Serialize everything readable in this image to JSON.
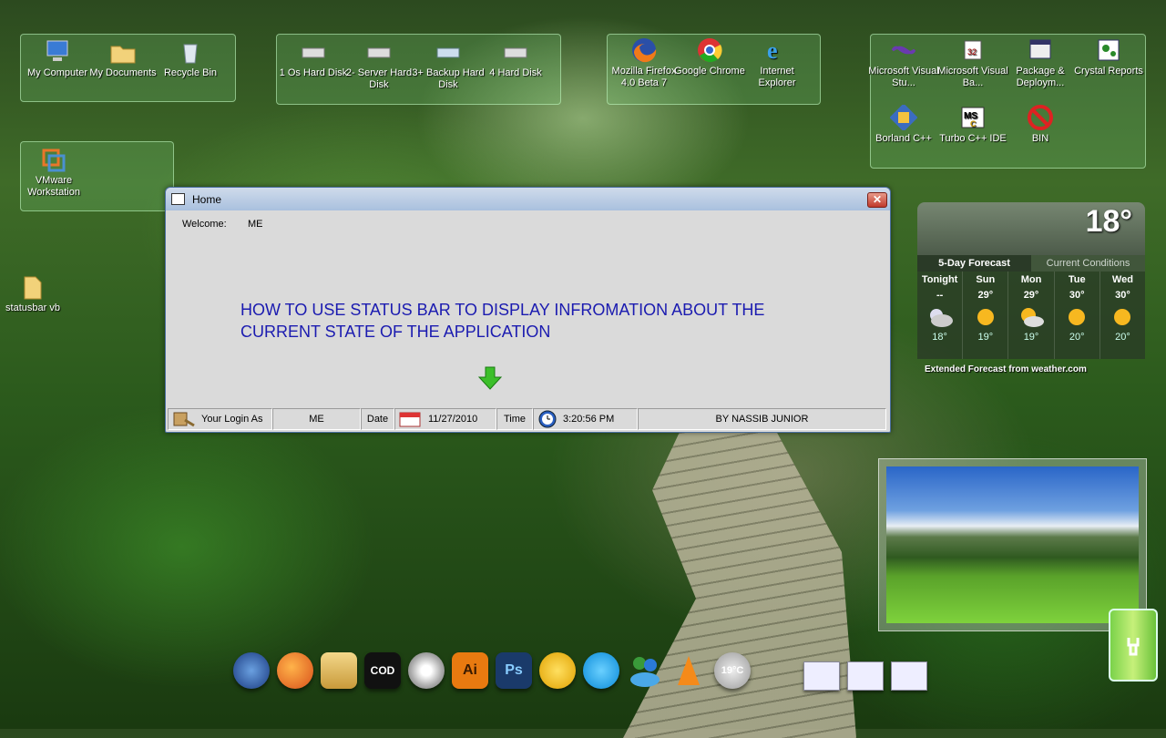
{
  "desktop": {
    "groups": [
      {
        "id": "g1",
        "items": [
          {
            "label": "My Computer",
            "icon": "computer-icon"
          },
          {
            "label": "My Documents",
            "icon": "folder-icon"
          },
          {
            "label": "Recycle Bin",
            "icon": "recycle-bin-icon"
          }
        ]
      },
      {
        "id": "g2",
        "items": [
          {
            "label": "1 Os Hard Disk",
            "icon": "hard-disk-icon"
          },
          {
            "label": "2- Server Hard Disk",
            "icon": "hard-disk-icon"
          },
          {
            "label": "3+ Backup Hard Disk",
            "icon": "hard-disk-icon"
          },
          {
            "label": "4 Hard Disk",
            "icon": "hard-disk-icon"
          }
        ]
      },
      {
        "id": "g3",
        "items": [
          {
            "label": "Mozilla Firefox 4.0 Beta 7",
            "icon": "firefox-icon"
          },
          {
            "label": "Google Chrome",
            "icon": "chrome-icon"
          },
          {
            "label": "Internet Explorer",
            "icon": "ie-icon"
          }
        ]
      },
      {
        "id": "g4",
        "items": [
          {
            "label": "Microsoft Visual Stu...",
            "icon": "visual-studio-icon"
          },
          {
            "label": "Microsoft Visual Ba...",
            "icon": "visual-basic-icon"
          },
          {
            "label": "Package & Deploym...",
            "icon": "package-icon"
          },
          {
            "label": "Crystal Reports",
            "icon": "crystal-reports-icon"
          },
          {
            "label": "Borland C++",
            "icon": "borland-icon"
          },
          {
            "label": "Turbo C++ IDE",
            "icon": "turbo-cpp-icon"
          },
          {
            "label": "BIN",
            "icon": "no-entry-icon"
          }
        ]
      },
      {
        "id": "g5",
        "items": [
          {
            "label": "VMware Workstation",
            "icon": "vmware-icon"
          }
        ]
      }
    ],
    "loose_icon": {
      "label": "statusbar vb",
      "icon": "folder-icon"
    }
  },
  "window": {
    "title": "Home",
    "close_label": "✕",
    "welcome_label": "Welcome:",
    "welcome_value": "ME",
    "message": "HOW TO USE STATUS BAR TO DISPLAY INFROMATION ABOUT THE CURRENT STATE OF THE APPLICATION",
    "status": {
      "login_label": "Your Login As",
      "login_value": "ME",
      "date_label": "Date",
      "date_value": "11/27/2010",
      "time_label": "Time",
      "time_value": "3:20:56 PM",
      "author": "BY NASSIB JUNIOR"
    }
  },
  "weather": {
    "current_temp": "18°",
    "tabs": [
      "5-Day Forecast",
      "Current Conditions"
    ],
    "days": [
      {
        "name": "Tonight",
        "hi": "--",
        "lo": "18°",
        "icon": "moon-cloud-icon"
      },
      {
        "name": "Sun",
        "hi": "29°",
        "lo": "19°",
        "icon": "sun-icon"
      },
      {
        "name": "Mon",
        "hi": "29°",
        "lo": "19°",
        "icon": "sun-cloud-icon"
      },
      {
        "name": "Tue",
        "hi": "30°",
        "lo": "20°",
        "icon": "sun-icon"
      },
      {
        "name": "Wed",
        "hi": "30°",
        "lo": "20°",
        "icon": "sun-icon"
      }
    ],
    "footer": "Extended Forecast from weather.com"
  },
  "dock": {
    "items": [
      {
        "icon": "windows-start-icon",
        "label": ""
      },
      {
        "icon": "firefox-icon",
        "label": ""
      },
      {
        "icon": "folder-icon",
        "label": ""
      },
      {
        "icon": "cod-icon",
        "label": "COD"
      },
      {
        "icon": "disc-icon",
        "label": ""
      },
      {
        "icon": "illustrator-icon",
        "label": "Ai"
      },
      {
        "icon": "photoshop-icon",
        "label": "Ps"
      },
      {
        "icon": "yahoo-icon",
        "label": ""
      },
      {
        "icon": "skype-icon",
        "label": ""
      },
      {
        "icon": "messenger-icon",
        "label": ""
      },
      {
        "icon": "vlc-icon",
        "label": ""
      },
      {
        "icon": "weather-icon",
        "label": "19°C"
      }
    ]
  }
}
